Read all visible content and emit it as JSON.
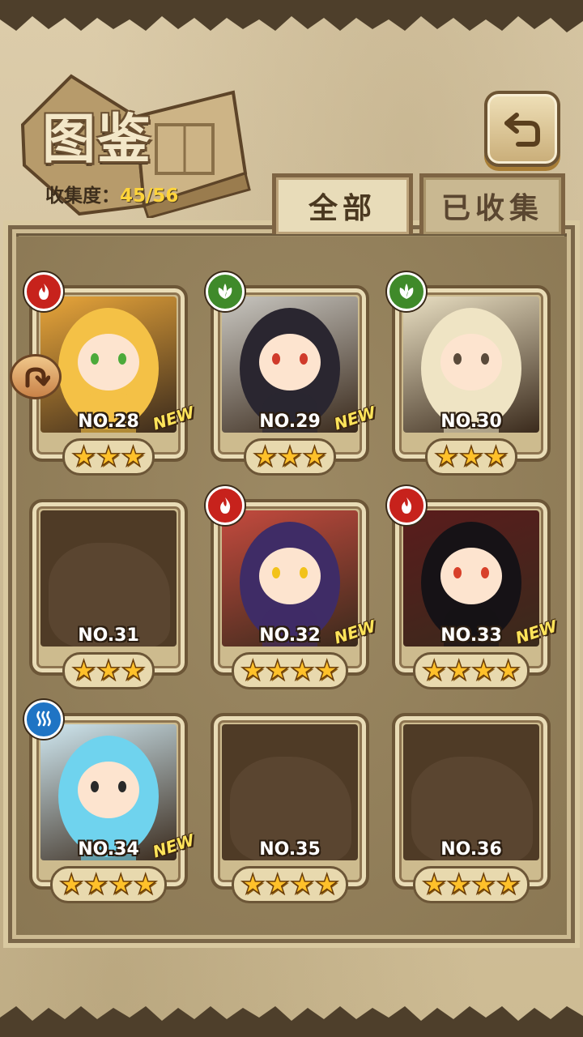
{
  "header": {
    "title": "图鉴",
    "collection_label": "收集度：",
    "collection_value": "45/56"
  },
  "tabs": [
    {
      "label": "全部",
      "active": true
    },
    {
      "label": "已收集",
      "active": false
    }
  ],
  "icons": {
    "back": "back-arrow-icon",
    "side_nav": "curved-arrow-icon",
    "fire": "fire-element-icon",
    "wood": "leaf-element-icon",
    "water": "water-element-icon"
  },
  "colors": {
    "fire": "#c7221c",
    "wood": "#3f8a2a",
    "water": "#1f74c4",
    "star": "#ffc12a",
    "collect_value": "#ffd43a"
  },
  "cards": [
    {
      "no": "NO.28",
      "stars": 3,
      "element": "fire",
      "new": "NEW",
      "unlocked": true
    },
    {
      "no": "NO.29",
      "stars": 3,
      "element": "wood",
      "new": "NEW",
      "unlocked": true
    },
    {
      "no": "NO.30",
      "stars": 3,
      "element": "wood",
      "new": "",
      "unlocked": true
    },
    {
      "no": "NO.31",
      "stars": 3,
      "element": "",
      "new": "",
      "unlocked": false
    },
    {
      "no": "NO.32",
      "stars": 4,
      "element": "fire",
      "new": "NEW",
      "unlocked": true
    },
    {
      "no": "NO.33",
      "stars": 4,
      "element": "fire",
      "new": "NEW",
      "unlocked": true
    },
    {
      "no": "NO.34",
      "stars": 4,
      "element": "water",
      "new": "NEW",
      "unlocked": true
    },
    {
      "no": "NO.35",
      "stars": 4,
      "element": "",
      "new": "",
      "unlocked": false
    },
    {
      "no": "NO.36",
      "stars": 4,
      "element": "",
      "new": "",
      "unlocked": false
    }
  ]
}
